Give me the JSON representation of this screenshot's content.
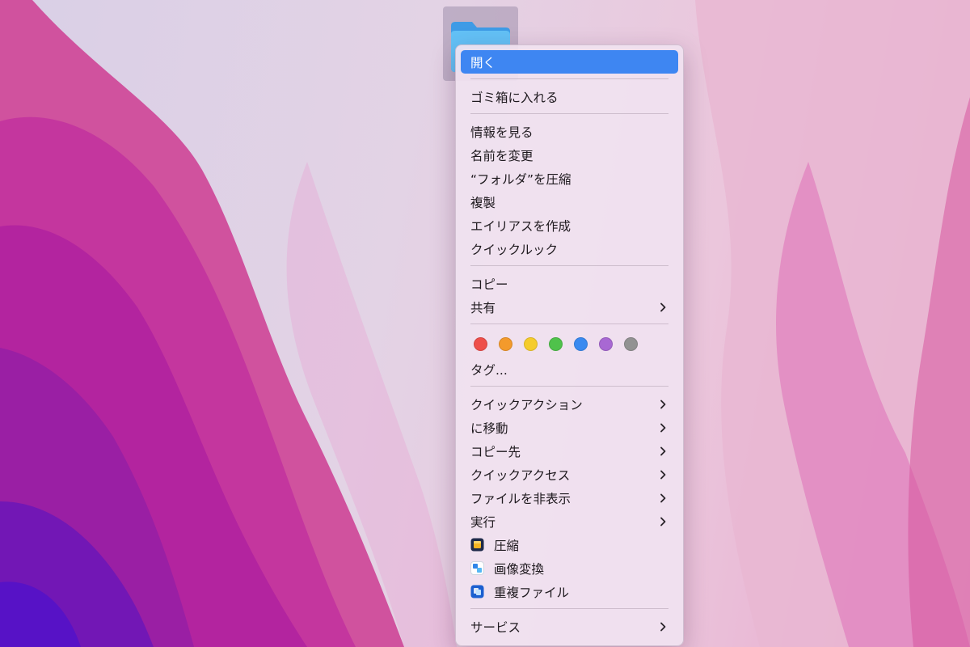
{
  "menu": {
    "sections": [
      [
        {
          "label": "開く",
          "submenu": false,
          "highlighted": true
        }
      ],
      [
        {
          "label": "ゴミ箱に入れる",
          "submenu": false
        }
      ],
      [
        {
          "label": "情報を見る",
          "submenu": false
        },
        {
          "label": "名前を変更",
          "submenu": false
        },
        {
          "label": "“フォルダ”を圧縮",
          "submenu": false
        },
        {
          "label": "複製",
          "submenu": false
        },
        {
          "label": "エイリアスを作成",
          "submenu": false
        },
        {
          "label": "クイックルック",
          "submenu": false
        }
      ],
      [
        {
          "label": "コピー",
          "submenu": false
        },
        {
          "label": "共有",
          "submenu": true
        }
      ]
    ],
    "tags": {
      "colors": [
        {
          "name": "red",
          "hex": "#ee4f4a"
        },
        {
          "name": "orange",
          "hex": "#f39a2c"
        },
        {
          "name": "yellow",
          "hex": "#f5cc2c"
        },
        {
          "name": "green",
          "hex": "#4fc24b"
        },
        {
          "name": "blue",
          "hex": "#3a8af0"
        },
        {
          "name": "purple",
          "hex": "#a868d3"
        },
        {
          "name": "gray",
          "hex": "#929292"
        }
      ],
      "label": "タグ..."
    },
    "sections_after_tags": [
      [
        {
          "label": "クイックアクション",
          "submenu": true
        },
        {
          "label": "に移動",
          "submenu": true
        },
        {
          "label": "コピー先",
          "submenu": true
        },
        {
          "label": "クイックアクセス",
          "submenu": true
        },
        {
          "label": "ファイルを非表示",
          "submenu": true
        },
        {
          "label": "実行",
          "submenu": true
        },
        {
          "label": "圧縮",
          "submenu": false,
          "icon": "archiver-app-icon"
        },
        {
          "label": "画像変換",
          "submenu": false,
          "icon": "image-converter-app-icon"
        },
        {
          "label": "重複ファイル",
          "submenu": false,
          "icon": "duplicate-files-app-icon"
        }
      ],
      [
        {
          "label": "サービス",
          "submenu": true
        }
      ]
    ]
  },
  "theme": {
    "highlight": "#3e86f2",
    "folder_blue": "#5ab8f3"
  }
}
